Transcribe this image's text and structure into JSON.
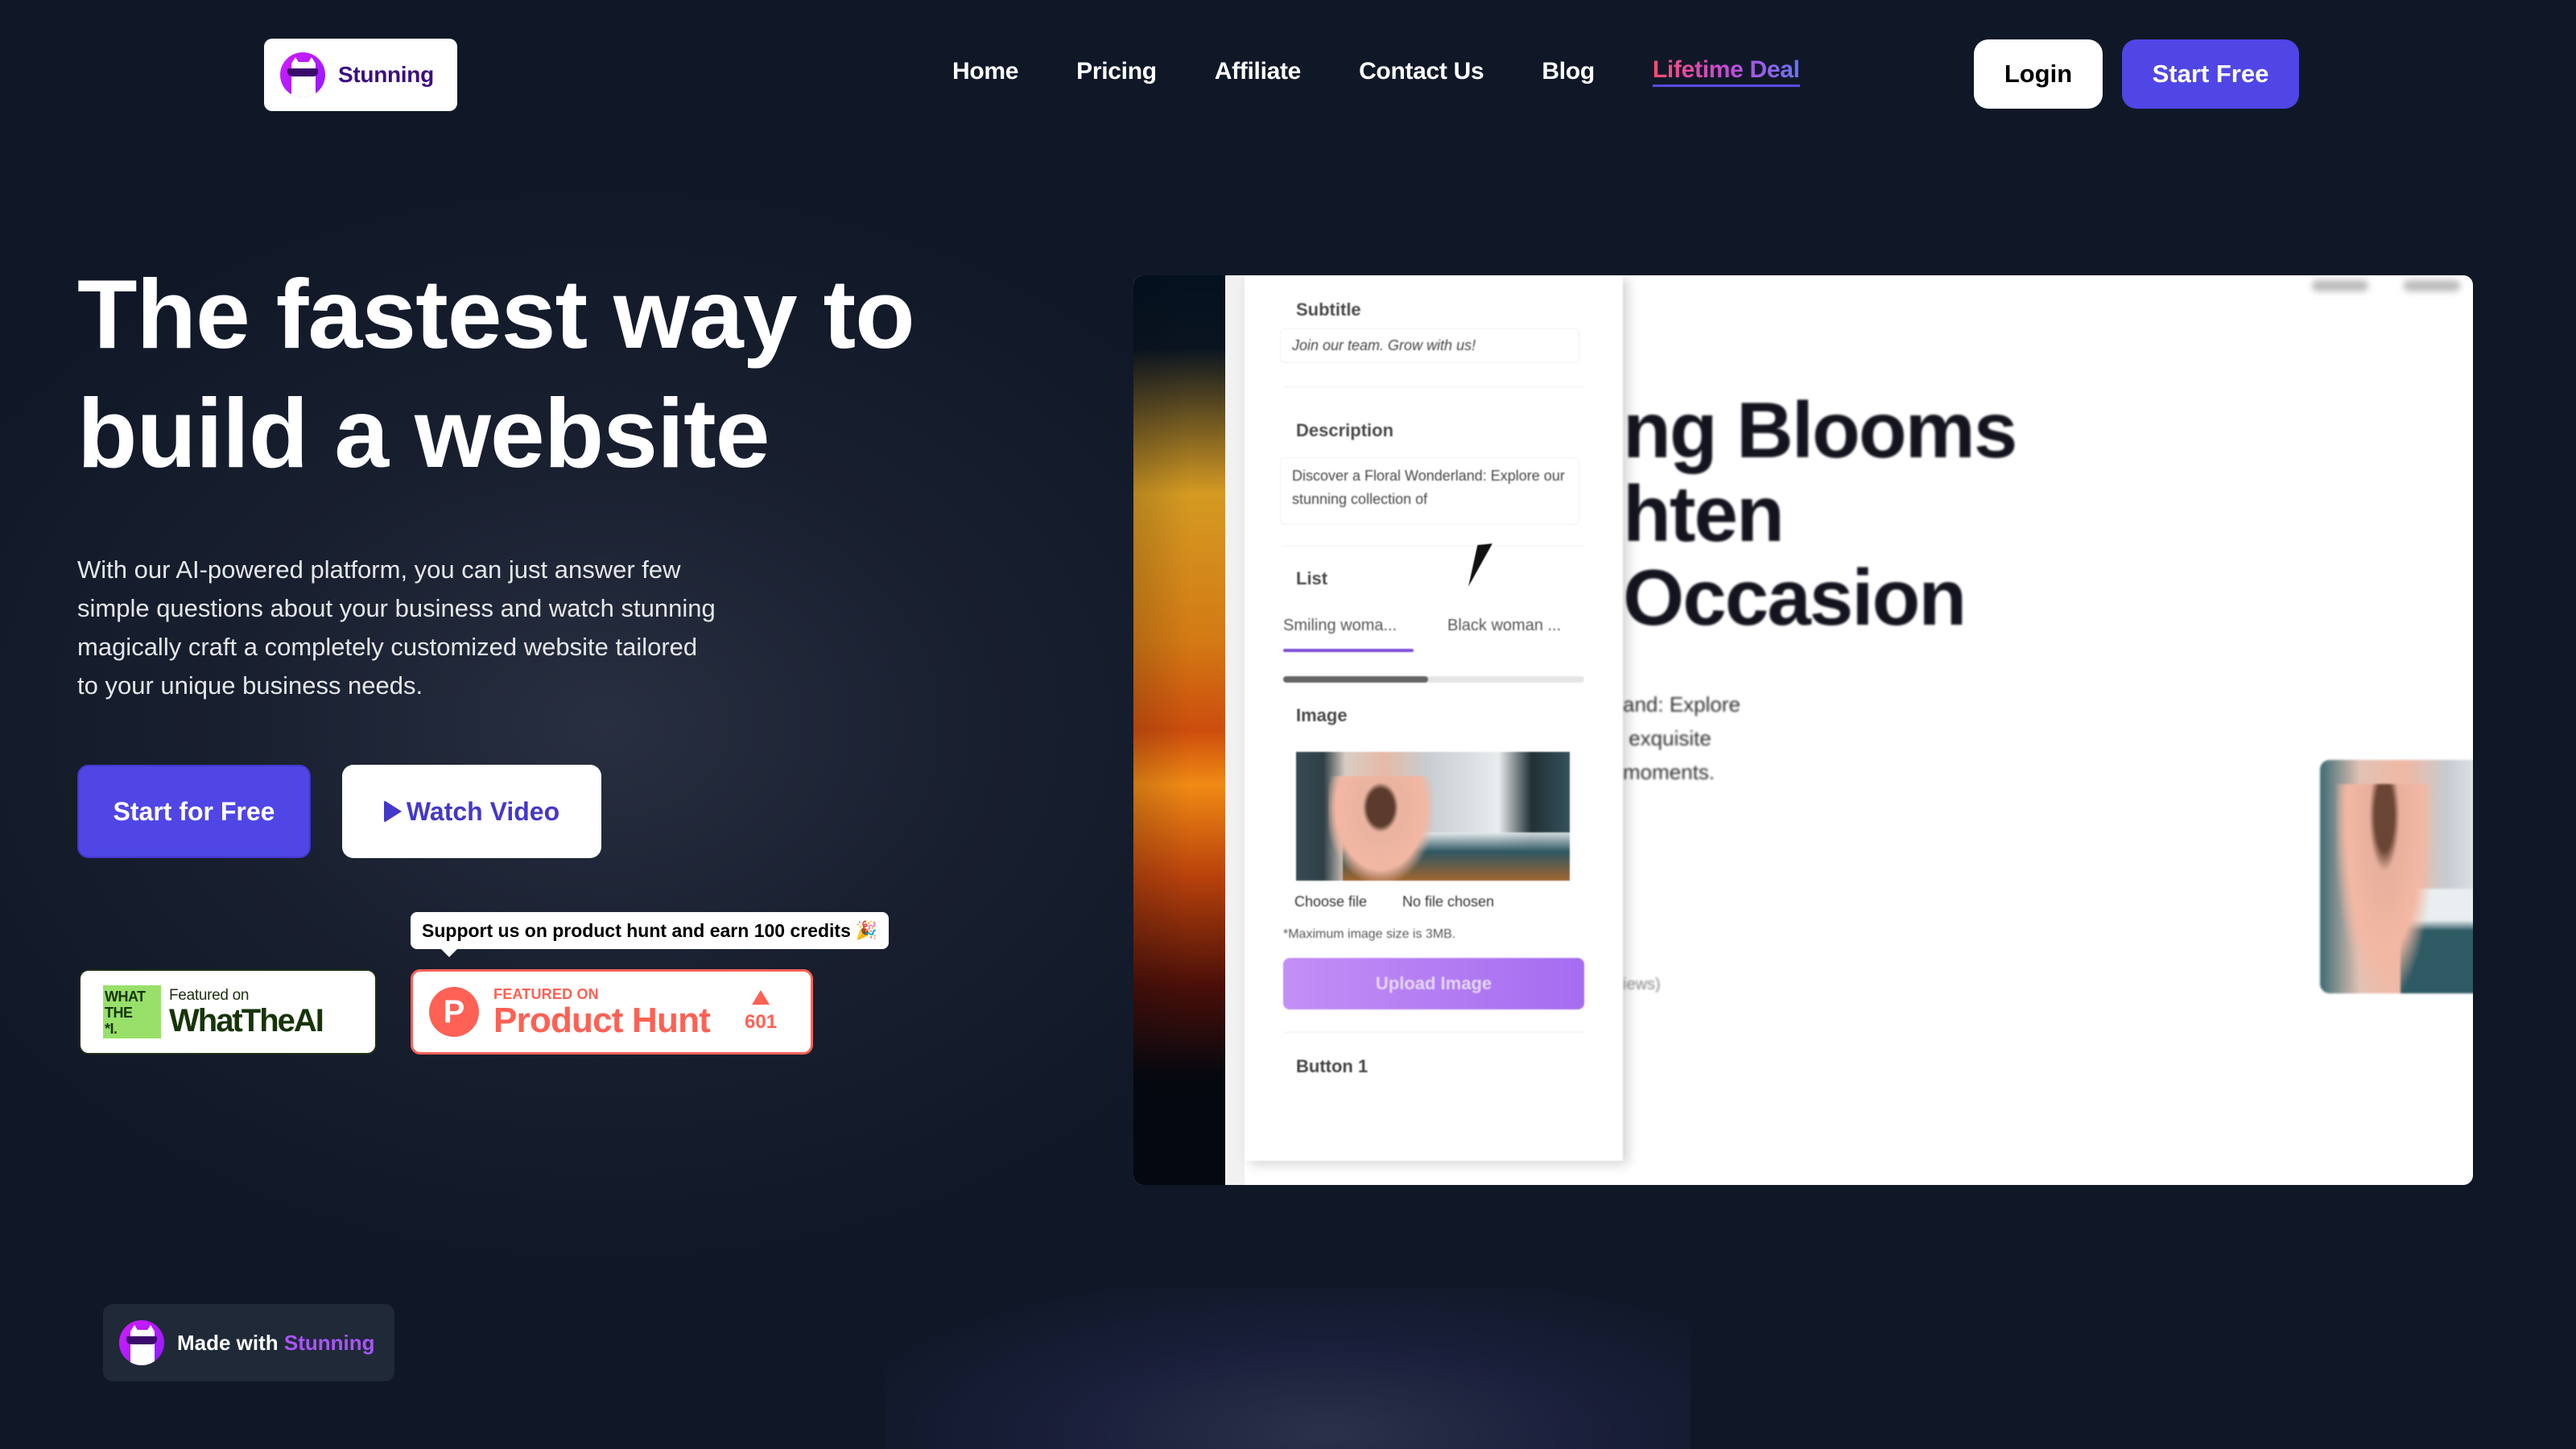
{
  "header": {
    "logo_text": "Stunning",
    "logo_icon": "cat-sunglasses-icon",
    "nav": [
      {
        "label": "Home"
      },
      {
        "label": "Pricing"
      },
      {
        "label": "Affiliate"
      },
      {
        "label": "Contact Us"
      },
      {
        "label": "Blog"
      },
      {
        "label": "Lifetime Deal",
        "highlight": true
      }
    ],
    "login_label": "Login",
    "start_free_label": "Start Free"
  },
  "hero": {
    "title": "The fastest way to build a website",
    "description": "With our AI-powered platform, you can just answer few simple questions about your business and watch stunning magically craft a completely customized website tailored to your unique business needs.",
    "primary_cta": "Start for Free",
    "secondary_cta": "Watch Video",
    "secondary_cta_icon": "play-icon"
  },
  "badges": {
    "whattheai": {
      "logo_lines": [
        "WHAT",
        "THE",
        "*I."
      ],
      "small": "Featured on",
      "big": "WhatTheAI"
    },
    "tooltip": {
      "text": "Support us on product hunt and earn 100 credits",
      "emoji": "🎉"
    },
    "producthunt": {
      "logo_letter": "P",
      "small": "FEATURED ON",
      "big": "Product Hunt",
      "votes": "601"
    }
  },
  "preview": {
    "editor": {
      "subtitle_label": "Subtitle",
      "subtitle_value": "Join our team. Grow with us!",
      "description_label": "Description",
      "description_value": "Discover a Floral Wonderland: Explore our stunning collection of",
      "list_label": "List",
      "list_tabs": [
        "Smiling woma...",
        "Black woman ..."
      ],
      "list_scroll_progress": 0.48,
      "image_label": "Image",
      "choose_file": "Choose file",
      "no_file": "No file chosen",
      "hint": "*Maximum image size is 3MB.",
      "upload_label": "Upload Image",
      "button1_label": "Button 1"
    },
    "site": {
      "title": "ng Blooms\nhten\nOccasion",
      "description": "and: Explore\n exquisite\nmoments.",
      "reviews": "iews)"
    }
  },
  "footer_badge": {
    "prefix": "Made with",
    "brand": "Stunning"
  },
  "colors": {
    "background": "#101828",
    "accent": "#4f46e5",
    "producthunt": "#ff6154",
    "brand_purple": "#a855f7"
  }
}
